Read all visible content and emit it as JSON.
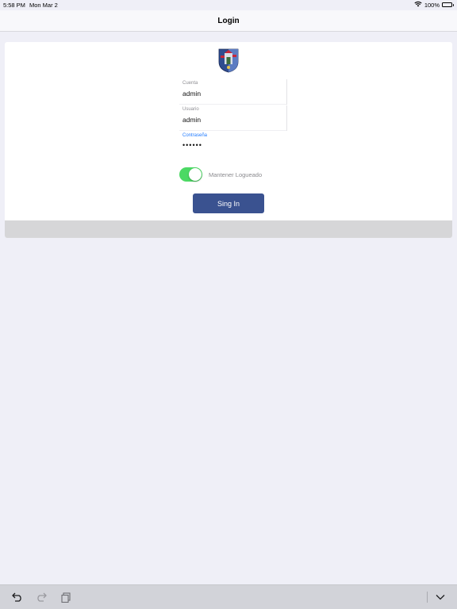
{
  "status_bar": {
    "time": "5:58 PM",
    "date": "Mon Mar 2",
    "battery": "100%",
    "battery_level": 1.0
  },
  "nav": {
    "title": "Login"
  },
  "form": {
    "cuenta": {
      "label": "Cuenta",
      "value": "admin"
    },
    "usuario": {
      "label": "Usuario",
      "value": "admin"
    },
    "contrasena": {
      "label": "Contraseña",
      "value": "••••••"
    },
    "keep_logged": {
      "label": "Mantener Logueado",
      "on": true
    },
    "submit_label": "Sing In"
  },
  "colors": {
    "accent": "#1f7aff",
    "button": "#3a5290",
    "toggle_on": "#4cd964",
    "background": "#efeff7"
  },
  "keyboard_toolbar": {
    "icons": [
      "undo-icon",
      "redo-icon",
      "paste-icon",
      "dismiss-keyboard-icon"
    ]
  }
}
